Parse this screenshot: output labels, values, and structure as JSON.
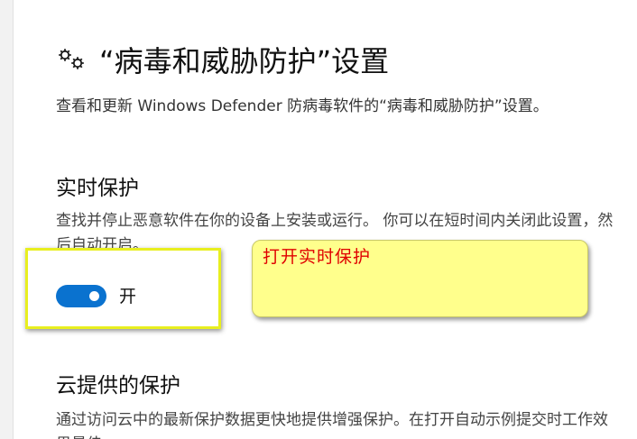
{
  "header": {
    "icon": "gears-icon",
    "title": "“病毒和威胁防护”设置",
    "description": "查看和更新 Windows Defender 防病毒软件的“病毒和威胁防护”设置。"
  },
  "realtime_protection": {
    "title": "实时保护",
    "description": "查找并停止恶意软件在你的设备上安装或运行。 你可以在短时间内关闭此设置，然后自动开启。",
    "toggle_state": "on",
    "toggle_label": "开"
  },
  "annotation": {
    "callout_text": "打开实时保护",
    "highlight_color": "#e8ef1f",
    "callout_color": "#ffff8c",
    "callout_text_color": "#e00000"
  },
  "cloud_protection": {
    "title": "云提供的保护",
    "description": "通过访问云中的最新保护数据更快地提供增强保护。在打开自动示例提交时工作效果最佳。"
  },
  "colors": {
    "toggle_on": "#0a72cf"
  }
}
